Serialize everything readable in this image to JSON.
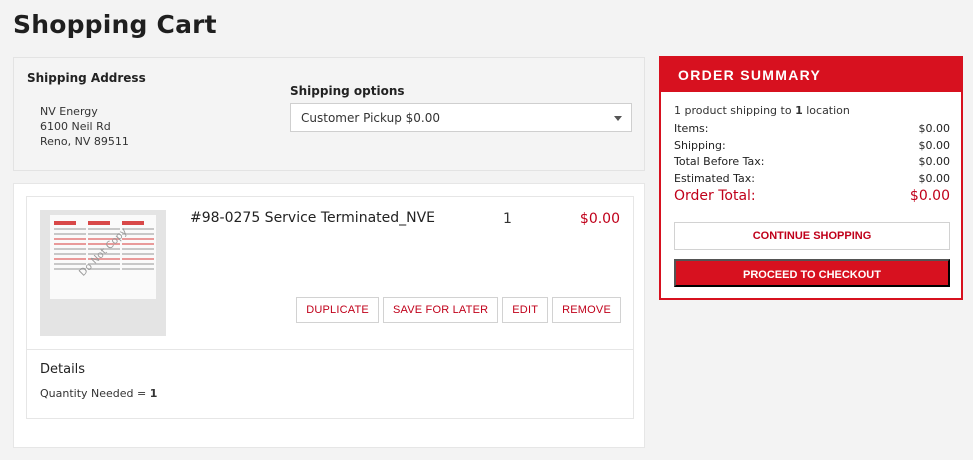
{
  "page": {
    "title": "Shopping Cart"
  },
  "shipping": {
    "address_heading": "Shipping Address",
    "address_lines": [
      "NV Energy",
      "6100 Neil Rd",
      "Reno, NV 89511"
    ],
    "options_heading": "Shipping options",
    "selected_option": "Customer Pickup $0.00"
  },
  "item": {
    "name": "#98-0275 Service Terminated_NVE",
    "quantity": "1",
    "price": "$0.00",
    "thumbnail_watermark": "Do Not Copy",
    "actions": {
      "duplicate": "DUPLICATE",
      "save_for_later": "SAVE FOR LATER",
      "edit": "EDIT",
      "remove": "REMOVE"
    },
    "details_heading": "Details",
    "details_label": "Quantity Needed = ",
    "details_value": "1"
  },
  "summary": {
    "heading": "ORDER SUMMARY",
    "line_prefix": "1 product shipping to ",
    "line_count": "1",
    "line_suffix": " location",
    "rows": [
      {
        "label": "Items:",
        "value": "$0.00"
      },
      {
        "label": "Shipping:",
        "value": "$0.00"
      },
      {
        "label": "Total Before Tax:",
        "value": "$0.00"
      },
      {
        "label": "Estimated Tax:",
        "value": "$0.00"
      }
    ],
    "total_label": "Order Total:",
    "total_value": "$0.00",
    "continue_label": "CONTINUE SHOPPING",
    "checkout_label": "PROCEED TO CHECKOUT"
  },
  "colors": {
    "accent": "#d7111f",
    "price": "#c0001a",
    "background": "#f3f3f3"
  },
  "icons": {
    "select_caret": "caret-down-icon"
  }
}
